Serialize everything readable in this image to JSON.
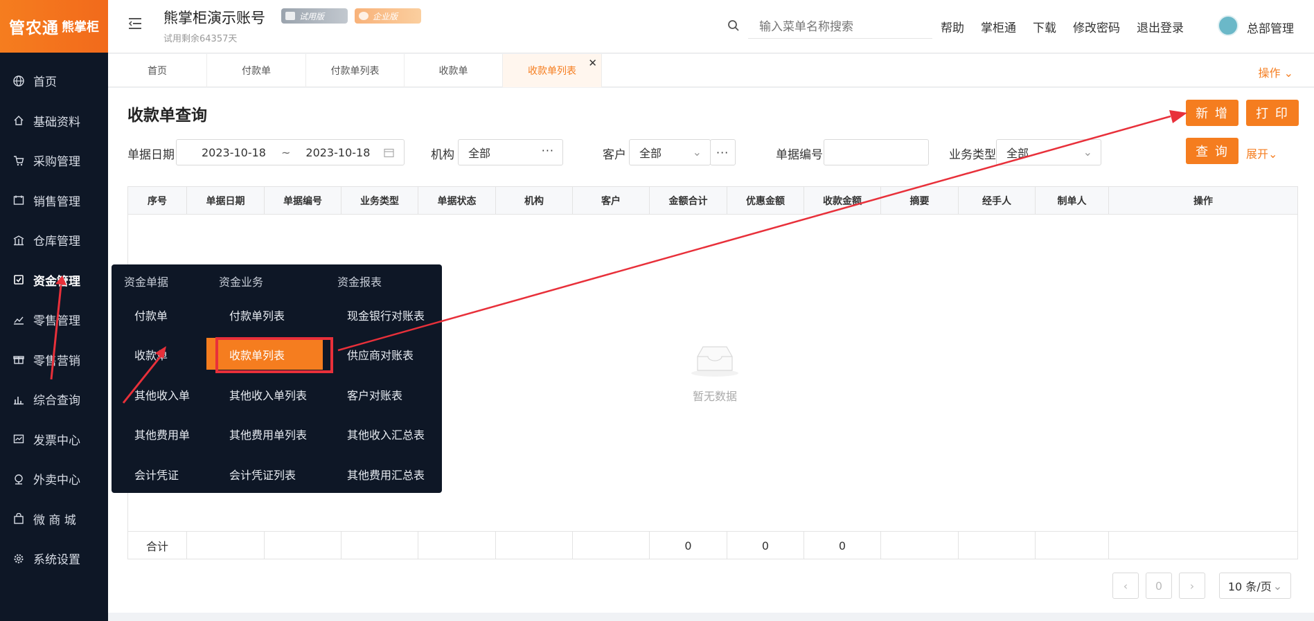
{
  "app": {
    "logo_main": "管农通",
    "logo_sub": "熊掌柜",
    "account_name": "熊掌柜演示账号",
    "badge_trial": "试用版",
    "badge_enterprise": "企业版",
    "remaining": "试用剩余64357天"
  },
  "search": {
    "placeholder": "输入菜单名称搜索"
  },
  "header_links": [
    "帮助",
    "掌柜通",
    "下载",
    "修改密码",
    "退出登录"
  ],
  "user": {
    "name": "总部管理"
  },
  "sidebar": {
    "items": [
      {
        "label": "首页",
        "icon": "globe-icon"
      },
      {
        "label": "基础资料",
        "icon": "home-icon"
      },
      {
        "label": "采购管理",
        "icon": "cart-icon"
      },
      {
        "label": "销售管理",
        "icon": "sales-icon"
      },
      {
        "label": "仓库管理",
        "icon": "warehouse-icon"
      },
      {
        "label": "资金管理",
        "icon": "finance-icon"
      },
      {
        "label": "零售管理",
        "icon": "chart-icon"
      },
      {
        "label": "零售营销",
        "icon": "gift-icon"
      },
      {
        "label": "综合查询",
        "icon": "bar-chart-icon"
      },
      {
        "label": "发票中心",
        "icon": "invoice-icon"
      },
      {
        "label": "外卖中心",
        "icon": "delivery-icon"
      },
      {
        "label": "微 商 城",
        "icon": "bag-icon"
      },
      {
        "label": "系统设置",
        "icon": "gear-icon"
      }
    ]
  },
  "tabs": [
    "首页",
    "付款单",
    "付款单列表",
    "收款单",
    "收款单列表"
  ],
  "tabs_ops": "操作",
  "page": {
    "title": "收款单查询",
    "btn_add": "新 增",
    "btn_print": "打 印",
    "btn_query": "查 询",
    "expand": "展开",
    "filters": {
      "date_label": "单据日期",
      "date_from": "2023-10-18",
      "date_sep": "~",
      "date_to": "2023-10-18",
      "org_label": "机构",
      "org_value": "全部",
      "customer_label": "客户",
      "customer_value": "全部",
      "doc_no_label": "单据编号",
      "biz_type_label": "业务类型",
      "biz_type_value": "全部"
    }
  },
  "table": {
    "headers": [
      "序号",
      "单据日期",
      "单据编号",
      "业务类型",
      "单据状态",
      "机构",
      "客户",
      "金额合计",
      "优惠金额",
      "收款金额",
      "摘要",
      "经手人",
      "制单人",
      "操作"
    ],
    "empty_text": "暂无数据",
    "footer": [
      "合计",
      "",
      "",
      "",
      "",
      "",
      "",
      "0",
      "0",
      "0",
      "",
      "",
      "",
      ""
    ]
  },
  "pager": {
    "page": "0",
    "size": "10 条/页"
  },
  "dropdown": {
    "headers": [
      "资金单据",
      "资金业务",
      "资金报表"
    ],
    "col1": [
      "付款单",
      "收款单",
      "其他收入单",
      "其他费用单",
      "会计凭证"
    ],
    "col2": [
      "付款单列表",
      "收款单列表",
      "其他收入单列表",
      "其他费用单列表",
      "会计凭证列表"
    ],
    "col3": [
      "现金银行对账表",
      "供应商对账表",
      "客户对账表",
      "其他收入汇总表",
      "其他费用汇总表"
    ]
  },
  "colors": {
    "accent": "#f57d1f",
    "sidebar_bg": "#0e1726",
    "annotation": "#e8303a"
  }
}
